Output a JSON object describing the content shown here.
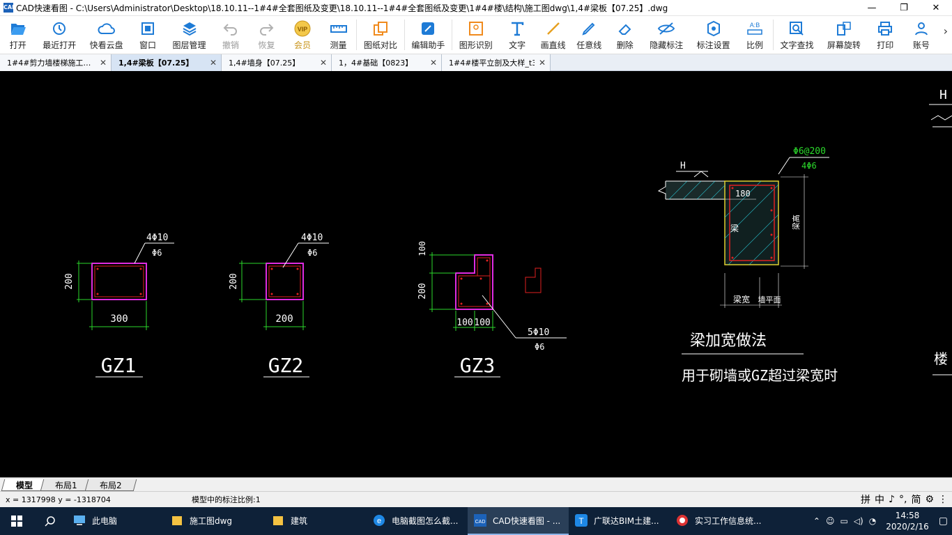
{
  "window": {
    "title": "CAD快速看图 - C:\\Users\\Administrator\\Desktop\\18.10.11--1#4#全套图纸及变更\\18.10.11--1#4#全套图纸及变更\\1#4#楼\\结构\\施工图dwg\\1,4#梁板【07.25】.dwg",
    "app_icon": "CAD",
    "minimize": "—",
    "maximize": "❐",
    "close": "✕"
  },
  "toolbar": [
    {
      "label": "打开",
      "icon": "folder-open-icon"
    },
    {
      "label": "最近打开",
      "icon": "history-icon"
    },
    {
      "label": "快看云盘",
      "icon": "cloud-icon"
    },
    {
      "label": "窗口",
      "icon": "window-icon"
    },
    {
      "label": "图层管理",
      "icon": "layers-icon"
    },
    {
      "label": "撤销",
      "icon": "undo-icon",
      "disabled": true
    },
    {
      "label": "恢复",
      "icon": "redo-icon",
      "disabled": true
    },
    {
      "label": "会员",
      "icon": "vip-icon"
    },
    {
      "label": "测量",
      "icon": "ruler-icon"
    },
    {
      "label": "图纸对比",
      "icon": "compare-icon"
    },
    {
      "label": "编辑助手",
      "icon": "edit-assistant-icon"
    },
    {
      "label": "图形识别",
      "icon": "shape-recognize-icon"
    },
    {
      "label": "文字",
      "icon": "text-icon"
    },
    {
      "label": "画直线",
      "icon": "line-icon"
    },
    {
      "label": "任意线",
      "icon": "pen-icon"
    },
    {
      "label": "删除",
      "icon": "eraser-icon"
    },
    {
      "label": "隐藏标注",
      "icon": "eye-hide-icon"
    },
    {
      "label": "标注设置",
      "icon": "settings-icon"
    },
    {
      "label": "比例",
      "icon": "scale-icon"
    },
    {
      "label": "文字查找",
      "icon": "text-search-icon"
    },
    {
      "label": "屏幕旋转",
      "icon": "rotate-screen-icon"
    },
    {
      "label": "打印",
      "icon": "printer-icon"
    },
    {
      "label": "账号",
      "icon": "user-icon"
    }
  ],
  "toolbar_more": "›",
  "tabs": [
    {
      "label": "1#4#剪力墙楼梯施工…",
      "active": false
    },
    {
      "label": "1,4#梁板【07.25】",
      "active": true
    },
    {
      "label": "1,4#墙身【07.25】",
      "active": false
    },
    {
      "label": "1，4#基础【0823】",
      "active": false
    },
    {
      "label": "1#4#楼平立剖及大样_t3",
      "active": false
    }
  ],
  "tab_close": "✕",
  "drawing": {
    "gz1": {
      "label": "GZ1",
      "rebar_main": "4Φ10",
      "rebar_stirrup": "Φ6",
      "dim_h": "200",
      "dim_w": "300"
    },
    "gz2": {
      "label": "GZ2",
      "rebar_main": "4Φ10",
      "rebar_stirrup": "Φ6",
      "dim_h": "200",
      "dim_w": "200"
    },
    "gz3": {
      "label": "GZ3",
      "rebar_main": "5Φ10",
      "rebar_stirrup": "Φ6",
      "dim_top": "100",
      "dim_h": "200",
      "dim_w1": "100",
      "dim_w2": "100"
    },
    "detail": {
      "title": "梁加宽做法",
      "note": "用于砌墙或GZ超过梁宽时",
      "rebar_stirrup": "Φ6@200",
      "rebar_main": "4Φ6",
      "elev": "H",
      "dim_180": "180",
      "label_beam": "梁",
      "label_height": "梁高",
      "label_beam_width": "梁宽",
      "label_wall_plane": "墙平面",
      "edge_label": "H",
      "edge_label2": "楼"
    },
    "colors": {
      "green": "#2bd92b",
      "magenta": "#e02be0",
      "red": "#e02020",
      "white": "#ffffff",
      "cyan": "#2bcfe0"
    }
  },
  "layout_tabs": [
    {
      "label": "模型",
      "active": true
    },
    {
      "label": "布局1",
      "active": false
    },
    {
      "label": "布局2",
      "active": false
    }
  ],
  "status": {
    "coords": "x = 1317998  y = -1318704",
    "scale_text": "模型中的标注比例:1",
    "ime": [
      "拼",
      "中",
      "♪",
      "°,",
      "简",
      "⚙",
      "⋮"
    ]
  },
  "taskbar": {
    "items": [
      {
        "label": "此电脑",
        "icon": "computer-icon",
        "active": false
      },
      {
        "label": "施工图dwg",
        "icon": "folder-icon",
        "active": false
      },
      {
        "label": "建筑",
        "icon": "folder-icon",
        "active": false
      },
      {
        "label": "电脑截图怎么截...",
        "icon": "edge-icon",
        "active": false
      },
      {
        "label": "CAD快速看图 - ...",
        "icon": "cad-icon",
        "active": true
      },
      {
        "label": "广联达BIM土建...",
        "icon": "glodon-icon",
        "active": false
      },
      {
        "label": "实习工作信息统...",
        "icon": "app-icon",
        "active": false
      }
    ],
    "time": "14:58",
    "date": "2020/2/16"
  }
}
